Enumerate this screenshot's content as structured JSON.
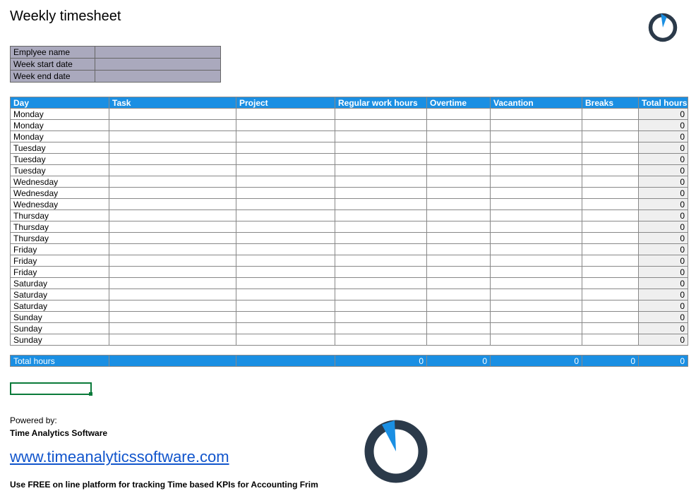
{
  "title": "Weekly timesheet",
  "meta": {
    "rows": [
      {
        "label": "Emplyee name",
        "value": ""
      },
      {
        "label": "Week start date",
        "value": ""
      },
      {
        "label": "Week end date",
        "value": ""
      }
    ]
  },
  "columns": [
    "Day",
    "Task",
    "Project",
    "Regular work hours",
    "Overtime",
    "Vacantion",
    "Breaks",
    "Total hours"
  ],
  "rows": [
    {
      "day": "Monday",
      "task": "",
      "project": "",
      "reg": "",
      "ot": "",
      "vac": "",
      "brk": "",
      "total": "0"
    },
    {
      "day": "Monday",
      "task": "",
      "project": "",
      "reg": "",
      "ot": "",
      "vac": "",
      "brk": "",
      "total": "0"
    },
    {
      "day": "Monday",
      "task": "",
      "project": "",
      "reg": "",
      "ot": "",
      "vac": "",
      "brk": "",
      "total": "0"
    },
    {
      "day": "Tuesday",
      "task": "",
      "project": "",
      "reg": "",
      "ot": "",
      "vac": "",
      "brk": "",
      "total": "0"
    },
    {
      "day": "Tuesday",
      "task": "",
      "project": "",
      "reg": "",
      "ot": "",
      "vac": "",
      "brk": "",
      "total": "0"
    },
    {
      "day": "Tuesday",
      "task": "",
      "project": "",
      "reg": "",
      "ot": "",
      "vac": "",
      "brk": "",
      "total": "0"
    },
    {
      "day": "Wednesday",
      "task": "",
      "project": "",
      "reg": "",
      "ot": "",
      "vac": "",
      "brk": "",
      "total": "0"
    },
    {
      "day": "Wednesday",
      "task": "",
      "project": "",
      "reg": "",
      "ot": "",
      "vac": "",
      "brk": "",
      "total": "0"
    },
    {
      "day": "Wednesday",
      "task": "",
      "project": "",
      "reg": "",
      "ot": "",
      "vac": "",
      "brk": "",
      "total": "0"
    },
    {
      "day": "Thursday",
      "task": "",
      "project": "",
      "reg": "",
      "ot": "",
      "vac": "",
      "brk": "",
      "total": "0"
    },
    {
      "day": "Thursday",
      "task": "",
      "project": "",
      "reg": "",
      "ot": "",
      "vac": "",
      "brk": "",
      "total": "0"
    },
    {
      "day": "Thursday",
      "task": "",
      "project": "",
      "reg": "",
      "ot": "",
      "vac": "",
      "brk": "",
      "total": "0"
    },
    {
      "day": "Friday",
      "task": "",
      "project": "",
      "reg": "",
      "ot": "",
      "vac": "",
      "brk": "",
      "total": "0"
    },
    {
      "day": "Friday",
      "task": "",
      "project": "",
      "reg": "",
      "ot": "",
      "vac": "",
      "brk": "",
      "total": "0"
    },
    {
      "day": "Friday",
      "task": "",
      "project": "",
      "reg": "",
      "ot": "",
      "vac": "",
      "brk": "",
      "total": "0"
    },
    {
      "day": "Saturday",
      "task": "",
      "project": "",
      "reg": "",
      "ot": "",
      "vac": "",
      "brk": "",
      "total": "0"
    },
    {
      "day": "Saturday",
      "task": "",
      "project": "",
      "reg": "",
      "ot": "",
      "vac": "",
      "brk": "",
      "total": "0"
    },
    {
      "day": "Saturday",
      "task": "",
      "project": "",
      "reg": "",
      "ot": "",
      "vac": "",
      "brk": "",
      "total": "0"
    },
    {
      "day": "Sunday",
      "task": "",
      "project": "",
      "reg": "",
      "ot": "",
      "vac": "",
      "brk": "",
      "total": "0"
    },
    {
      "day": "Sunday",
      "task": "",
      "project": "",
      "reg": "",
      "ot": "",
      "vac": "",
      "brk": "",
      "total": "0"
    },
    {
      "day": "Sunday",
      "task": "",
      "project": "",
      "reg": "",
      "ot": "",
      "vac": "",
      "brk": "",
      "total": "0"
    }
  ],
  "totals": {
    "label": "Total hours",
    "reg": "0",
    "ot": "0",
    "vac": "0",
    "brk": "0",
    "total": "0"
  },
  "footer": {
    "powered": "Powered by:",
    "brand": "Time Analytics Software",
    "link": "www.timeanalyticssoftware.com",
    "tagline": "Use FREE on line platform for tracking Time based KPIs for Accounting Frim"
  }
}
